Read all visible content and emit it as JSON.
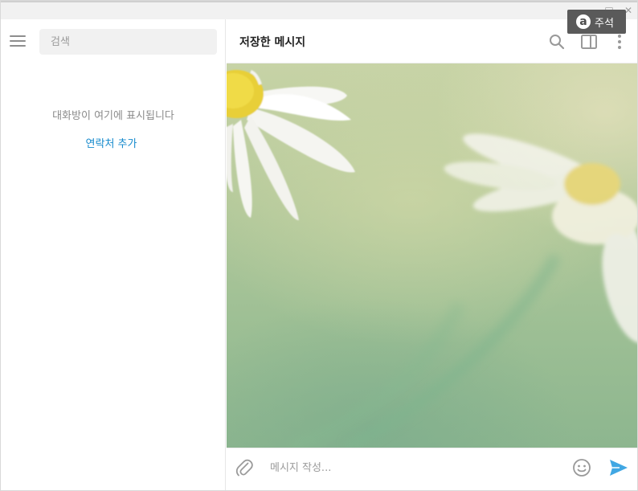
{
  "window": {
    "controls": {
      "maximize_glyph": "□",
      "close_glyph": "✕"
    }
  },
  "annotation": {
    "label": "주석",
    "icon_letter": "a"
  },
  "sidebar": {
    "search_placeholder": "검색",
    "empty_text": "대화방이 여기에 표시됩니다",
    "add_contact_label": "연락처 추가"
  },
  "chat": {
    "title": "저장한 메시지",
    "header_icons": [
      "search-icon",
      "sidebar-toggle-icon",
      "more-vertical-icon"
    ],
    "input_placeholder": "메시지 작성...",
    "input_icons": [
      "paperclip-icon",
      "emoji-icon",
      "send-icon"
    ]
  },
  "colors": {
    "accent": "#168acd",
    "send": "#40a7e3",
    "icon_gray": "#999999",
    "annotation_badge": "#5a5a5a"
  }
}
